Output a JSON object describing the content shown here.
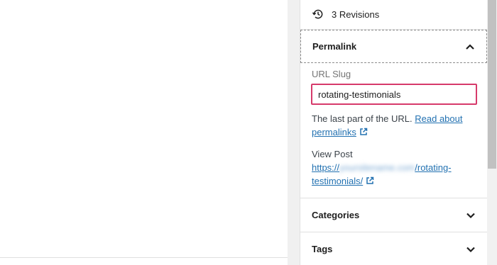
{
  "sidebar": {
    "revisions": {
      "label": "3 Revisions",
      "icon": "history-icon"
    },
    "permalink": {
      "title": "Permalink",
      "slug_label": "URL Slug",
      "slug_value": "rotating-testimonials",
      "help_text": "The last part of the URL.",
      "help_link": "Read about permalinks",
      "view_label": "View Post",
      "url_prefix": "https://",
      "url_domain_blurred": "yoursitename.com",
      "url_path": "/rotating-testimonials/"
    },
    "categories": {
      "title": "Categories"
    },
    "tags": {
      "title": "Tags"
    }
  },
  "colors": {
    "link": "#2271b1",
    "input_focus_border": "#d63a6b",
    "divider": "#e0e0e0"
  }
}
